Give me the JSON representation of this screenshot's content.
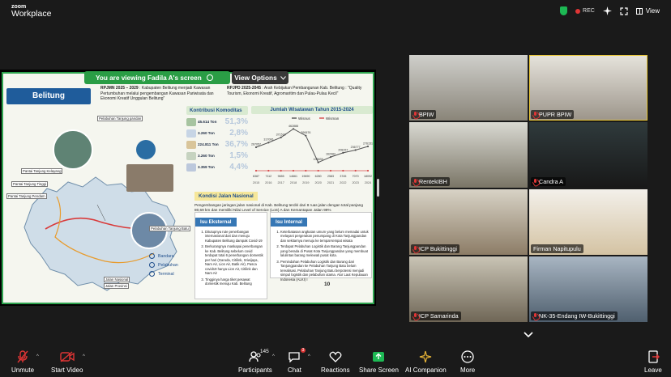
{
  "app": {
    "brand_line1": "zoom",
    "brand_line2": "Workplace"
  },
  "topbar": {
    "rec_label": "REC",
    "view_label": "View"
  },
  "share": {
    "banner": "You are viewing  Fadila A's screen",
    "view_options": "View Options"
  },
  "slide": {
    "title": "Belitung",
    "rpjmn_head": "RPJMN 2025 – 2029",
    "rpjmn_text": " : Kabupaten Belitung menjadi Kawasan Pertumbuhan melalui pengembangan Kawasan Pariwisata dan Ekonomi Kreatif Unggulan Belitung\"",
    "rpjpd_head": "RPJPD 2025-2045",
    "rpjpd_text": " : Arah Kebijakan Pembangunan Kab. Belitung : \"Quality Tourism, Ekonomi Kreatif, Agromaritim dan Pulau-Pulau Kecil\"",
    "kontribusi_title": "Kontribusi Komoditas",
    "komoditas": [
      {
        "value": "45.614 Ton",
        "pct": "51,3%"
      },
      {
        "value": "3.260 Ton",
        "pct": "2,8%"
      },
      {
        "value": "224.811 Ton",
        "pct": "36,7%"
      },
      {
        "value": "3.260 Ton",
        "pct": "1,5%"
      },
      {
        "value": "3.359 Ton",
        "pct": "4,4%"
      }
    ],
    "wisatawan_title": "Jumlah Wisatawan Tahun 2015-2024",
    "wisatawan_legend": [
      "Wisman",
      "Wisnus"
    ],
    "kondisi_title": "Kondisi Jalan Nasional",
    "kondisi_text": "Pengembangan jaringan jalan nasional di Kab. Belitung terdiri dari 8 ruas jalan dengan total panjang 80,69 km dan memiliki Nilai Level of Service (LoS) A dan Kemantapan Jalan 99%",
    "isu_eksternal_title": "Isu Eksternal",
    "isu_eksternal": [
      "Ditutupnya rute penerbangan internasional dari dan menuju Kabupaten Belitung dampak Covid-19",
      "Berkurangnya maskapai penerbangan ke Kab. Belitung sebelum covid terdapat total 6 penerbangan domestik per hari (Garuda, Citilink, Sriwijaya, Nam Air, Lion Air, Batik Air), Pasca covid19 hanya Lion Air, Citilink dan Nam Air",
      "Tingginya harga tiket pesawat domestik menuju Kab. Belitung"
    ],
    "isu_internal_title": "Isu Internal",
    "isu_internal": [
      "Keterbatasan angkutan umum yang belum memadai untuk melayani pergerakan penumpang di Kota Tanjungpandan dan sekitarnya menuju ke tempat-tempat wisata",
      "Terdapat Pelabuhan Logistik dan Barang Tanjungpandan yang berada di Pusat Kota Tanjungpandan yang membuat lalulintas barang melewati pusat kota.",
      "Pemindahan Pelabuhan Logistik dan Barang dari Tanjungpandan ke Pelabuhan Tanjung Batu belum terealisasi. Pelabuhan Tanjung Batu berpotensi menjadi simpul logistik dan pelabuhan utama. Alur Laut Kepulauan Indonesia (ALKI) I"
    ],
    "page_number": "10",
    "map_legend": [
      "Bandara",
      "Pelabuhan",
      "Terminal"
    ],
    "map_labels": [
      "Pelabuhan Tanjung pandan",
      "Pantai Tanjung Kelayang",
      "Pantai Tanjung Tinggi",
      "Pantai Tanjung Pendam",
      "Pelabuhan Tanjung Batu",
      "Jalan Nasional",
      "Jalan Provinsi"
    ]
  },
  "chart_data": {
    "type": "line",
    "title": "Jumlah Wisatawan Tahun 2015-2024",
    "categories": [
      "2015",
      "2016",
      "2017",
      "2018",
      "2019",
      "2020",
      "2021",
      "2022",
      "2023",
      "2024"
    ],
    "series": [
      {
        "name": "Wisnus",
        "values": [
          267057,
          317006,
          371516,
          462888,
          390676,
          105839,
          162982,
          208157,
          236777,
          276151
        ]
      },
      {
        "name": "Wisman",
        "values": [
          6387,
          7112,
          9655,
          14661,
          19690,
          6280,
          2583,
          3745,
          7070,
          18092
        ]
      }
    ],
    "colors": {
      "Wisnus": "#555555",
      "Wisman": "#d84a4a"
    }
  },
  "participants": [
    {
      "name": "BPIW",
      "muted": true
    },
    {
      "name": "PUPR BPIW",
      "muted": true
    },
    {
      "name": "RentekIBH",
      "muted": true
    },
    {
      "name": "Candra A",
      "muted": true
    },
    {
      "name": "ICP Bukittinggi",
      "muted": true
    },
    {
      "name": "Firman Napitupulu",
      "muted": false
    },
    {
      "name": "ICP Samarinda",
      "muted": true
    },
    {
      "name": "NK-35-Endang IW-Bukittinggi",
      "muted": true
    }
  ],
  "toolbar": {
    "unmute": "Unmute",
    "start_video": "Start Video",
    "participants": "Participants",
    "participants_count": "145",
    "chat": "Chat",
    "chat_badge": "3",
    "reactions": "Reactions",
    "share_screen": "Share Screen",
    "ai_companion": "AI Companion",
    "more": "More",
    "leave": "Leave"
  }
}
